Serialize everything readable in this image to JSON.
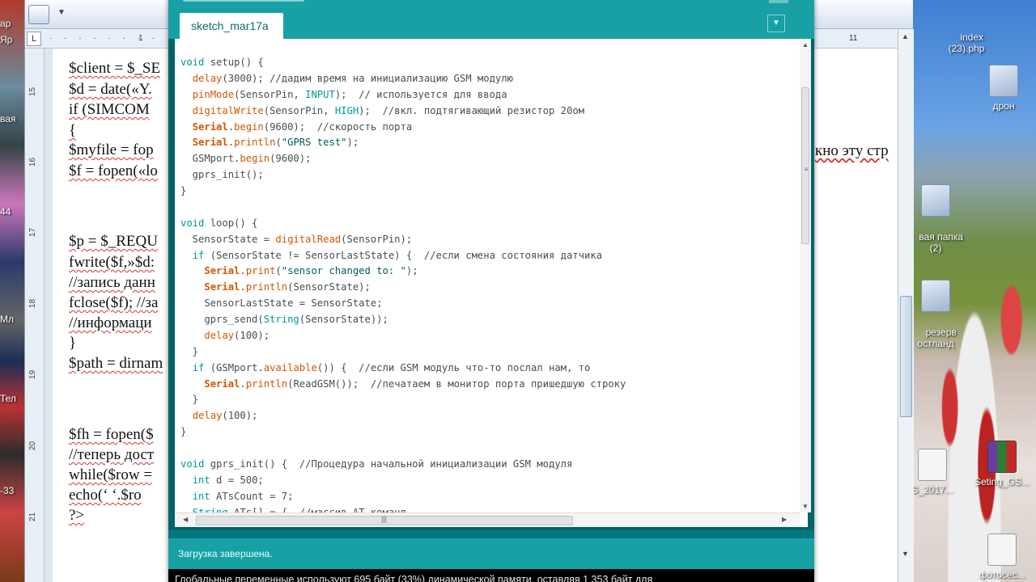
{
  "left_desktop": {
    "labels": [
      "ар",
      "Яр",
      "вая",
      "44",
      "Мл",
      "Тел",
      "-33"
    ]
  },
  "desktop": {
    "icons": [
      {
        "label": "index\n(23).php",
        "kind": "doc"
      },
      {
        "label": "дрон",
        "kind": "folder"
      },
      {
        "label": "вая папка\n(2)",
        "kind": "folder"
      },
      {
        "label": "резерв\nостланд",
        "kind": "folder"
      },
      {
        "label": "S_2017...",
        "kind": "doc"
      },
      {
        "label": "Seting_GS...",
        "kind": "rar"
      },
      {
        "label": "фотосес...",
        "kind": "doc"
      }
    ]
  },
  "word": {
    "ruler_left": "1",
    "ruler_right": "11",
    "vruler": [
      "15",
      "16",
      "17",
      "18",
      "19",
      "20",
      "21"
    ],
    "right_fragment": "кно эту стр",
    "lines": [
      "$client = $_SE",
      "$d = date(«Y.",
      "if (SIMCOM",
      "{",
      "$myfile = fop",
      "$f = fopen(«lo",
      "$p = $_REQU",
      "fwrite($f,»$d:",
      "//запись данн",
      "fclose($f); //за",
      "//информаци",
      "}",
      "$path = dirnam",
      "$fh = fopen($",
      "//теперь дост",
      "while($row =",
      "echo(‘ ‘.$ro",
      "?>"
    ]
  },
  "ide": {
    "tab_label": "sketch_mar17a",
    "tab_menu_icon": "▼",
    "status_text": "Загрузка завершена.",
    "console_text": "Глобальные переменные используют 695 байт (33%) динамической памяти, оставляя 1 353 байт для",
    "code_lines": [
      "void setup() {",
      "  delay(3000); //дадим время на инициализацию GSM модулю",
      "  pinMode(SensorPin, INPUT);  // используется для ввода",
      "  digitalWrite(SensorPin, HIGH);  //вкл. подтягивающий резистор 20ом",
      "  Serial.begin(9600);  //скорость порта",
      "  Serial.println(\"GPRS test\");",
      "  GSMport.begin(9600);",
      "  gprs_init();",
      "}",
      "",
      "void loop() {",
      "  SensorState = digitalRead(SensorPin);",
      "  if (SensorState != SensorLastState) {  //если смена состояния датчика",
      "    Serial.print(\"sensor changed to: \");",
      "    Serial.println(SensorState);",
      "    SensorLastState = SensorState;",
      "    gprs_send(String(SensorState));",
      "    delay(100);",
      "  }",
      "  if (GSMport.available()) {  //если GSM модуль что-то послал нам, то",
      "    Serial.println(ReadGSM());  //печатаем в монитор порта пришедшую строку",
      "  }",
      "  delay(100);",
      "}",
      "",
      "void gprs_init() {  //Процедура начальной инициализации GSM модуля",
      "  int d = 500;",
      "  int ATsCount = 7;",
      "  String ATs[] = {  //массив АТ команд"
    ]
  },
  "colors": {
    "ide_header": "#17a1a5",
    "ide_dark": "#006468",
    "keyword": "#00979c",
    "function": "#d35400"
  }
}
